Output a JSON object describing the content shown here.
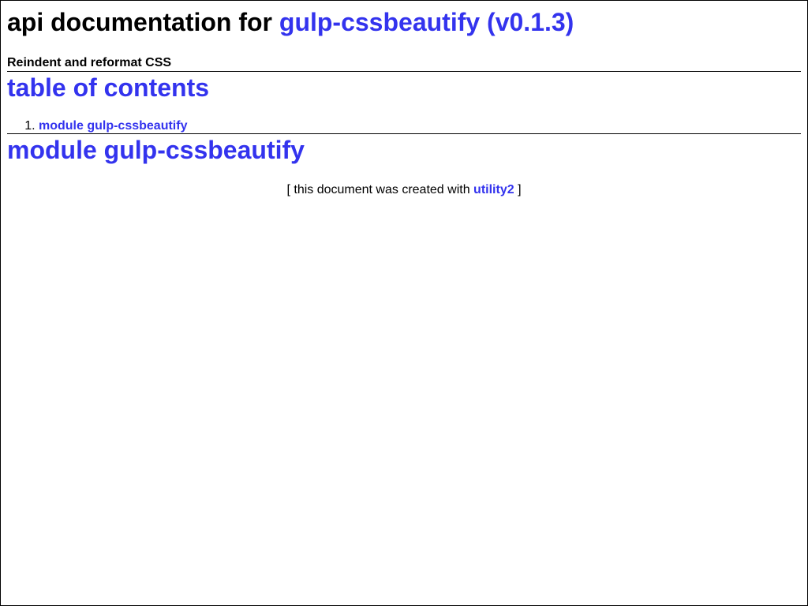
{
  "header": {
    "title_prefix": "api documentation for",
    "title_link": "gulp-cssbeautify (v0.1.3)",
    "subtitle": "Reindent and reformat CSS"
  },
  "toc": {
    "heading": "table of contents",
    "items": [
      {
        "number": "1.",
        "label": "module gulp-cssbeautify"
      }
    ]
  },
  "module": {
    "heading": "module gulp-cssbeautify"
  },
  "footer": {
    "open_bracket": "[",
    "text": "this document was created with",
    "link": "utility2",
    "close_bracket": "]"
  },
  "colors": {
    "link": "#3333ee",
    "text": "#000000",
    "background": "#ffffff"
  }
}
